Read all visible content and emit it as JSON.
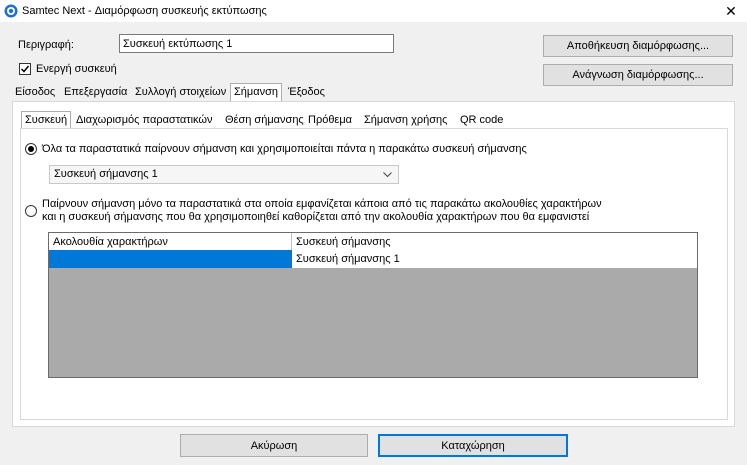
{
  "window": {
    "title": "Samtec Next - Διαμόρφωση συσκευής εκτύπωσης",
    "close_glyph": "✕"
  },
  "form": {
    "description_label": "Περιγραφή:",
    "description_value": "Συσκευή εκτύπωσης 1",
    "active_label": "Ενεργή συσκευή",
    "active_checked": true,
    "save_config_button": "Αποθήκευση διαμόρφωσης...",
    "read_config_button": "Ανάγνωση διαμόρφωσης..."
  },
  "main_tabs": [
    {
      "label": "Είσοδος",
      "selected": false
    },
    {
      "label": "Επεξεργασία",
      "selected": false
    },
    {
      "label": "Συλλογή στοιχείων",
      "selected": false
    },
    {
      "label": "Σήμανση",
      "selected": true
    },
    {
      "label": "Έξοδος",
      "selected": false
    }
  ],
  "sub_tabs": [
    {
      "label": "Συσκευή",
      "selected": true
    },
    {
      "label": "Διαχωρισμός παραστατικών",
      "selected": false
    },
    {
      "label": "Θέση σήμανσης",
      "selected": false
    },
    {
      "label": "Πρόθεμα",
      "selected": false
    },
    {
      "label": "Σήμανση χρήσης",
      "selected": false
    },
    {
      "label": "QR code",
      "selected": false
    }
  ],
  "option_all": {
    "label": "Όλα τα παραστατικά παίρνουν σήμανση και χρησιμοποιείται πάντα η παρακάτω συσκευή σήμανσης",
    "selected": true,
    "device_combo_value": "Συσκευή σήμανσης 1"
  },
  "option_sequences": {
    "label_line1": "Παίρνουν σήμανση μόνο τα παραστατικά στα οποία εμφανίζεται κάποια από τις παρακάτω ακολουθίες χαρακτήρων",
    "label_line2": "και η συσκευή σήμανσης που θα χρησιμοποιηθεί καθορίζεται από την ακολουθία χαρακτήρων που θα εμφανιστεί",
    "selected": false
  },
  "grid": {
    "columns": [
      "Ακολουθία χαρακτήρων",
      "Συσκευή σήμανσης"
    ],
    "rows": [
      {
        "sequence": "",
        "device": "Συσκευή σήμανσης 1"
      }
    ],
    "selection_color": "#0078d7",
    "empty_area_color": "#aaaaaa"
  },
  "footer": {
    "cancel_button": "Ακύρωση",
    "ok_button": "Καταχώρηση"
  },
  "icons": {
    "app": "printer-icon",
    "close": "close-icon",
    "check": "checkmark-icon",
    "combo_arrow": "chevron-down-icon"
  }
}
